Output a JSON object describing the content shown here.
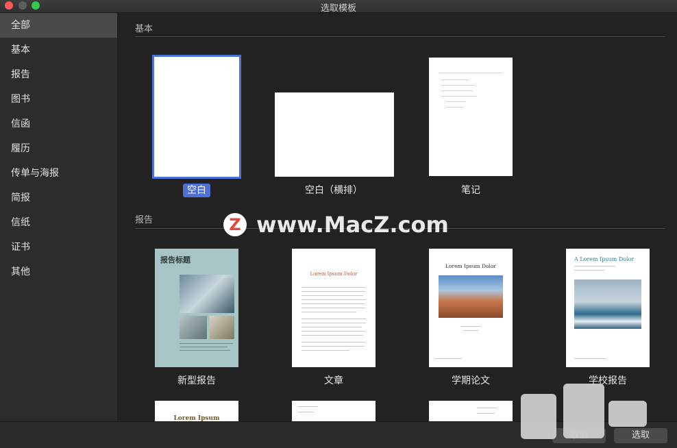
{
  "window": {
    "title": "选取模板"
  },
  "sidebar": {
    "items": [
      {
        "label": "全部",
        "selected": true
      },
      {
        "label": "基本"
      },
      {
        "label": "报告"
      },
      {
        "label": "图书"
      },
      {
        "label": "信函"
      },
      {
        "label": "履历"
      },
      {
        "label": "传单与海报"
      },
      {
        "label": "简报"
      },
      {
        "label": "信纸"
      },
      {
        "label": "证书"
      },
      {
        "label": "其他"
      }
    ]
  },
  "sections": {
    "basic": {
      "title": "基本",
      "templates": [
        {
          "label": "空白",
          "selected": true
        },
        {
          "label": "空白（横排）"
        },
        {
          "label": "笔记"
        }
      ]
    },
    "report": {
      "title": "报告",
      "templates": [
        {
          "label": "新型报告",
          "cover_title": "报告标题"
        },
        {
          "label": "文章",
          "heading": "Lorem Ipsum Dolor"
        },
        {
          "label": "学期论文",
          "heading": "Lorem Ipsum Dolor"
        },
        {
          "label": "学校报告",
          "heading": "A Lorem Ipsum Dolor"
        }
      ],
      "partial": [
        {
          "heading": "Lorem Ipsum"
        }
      ]
    }
  },
  "footer": {
    "cancel_label": "取消",
    "choose_label": "选取"
  },
  "watermark": {
    "logo": "Z",
    "text": "www.MacZ.com"
  },
  "colors": {
    "accent": "#4e73d8",
    "selection_badge": "#4f71d6"
  }
}
